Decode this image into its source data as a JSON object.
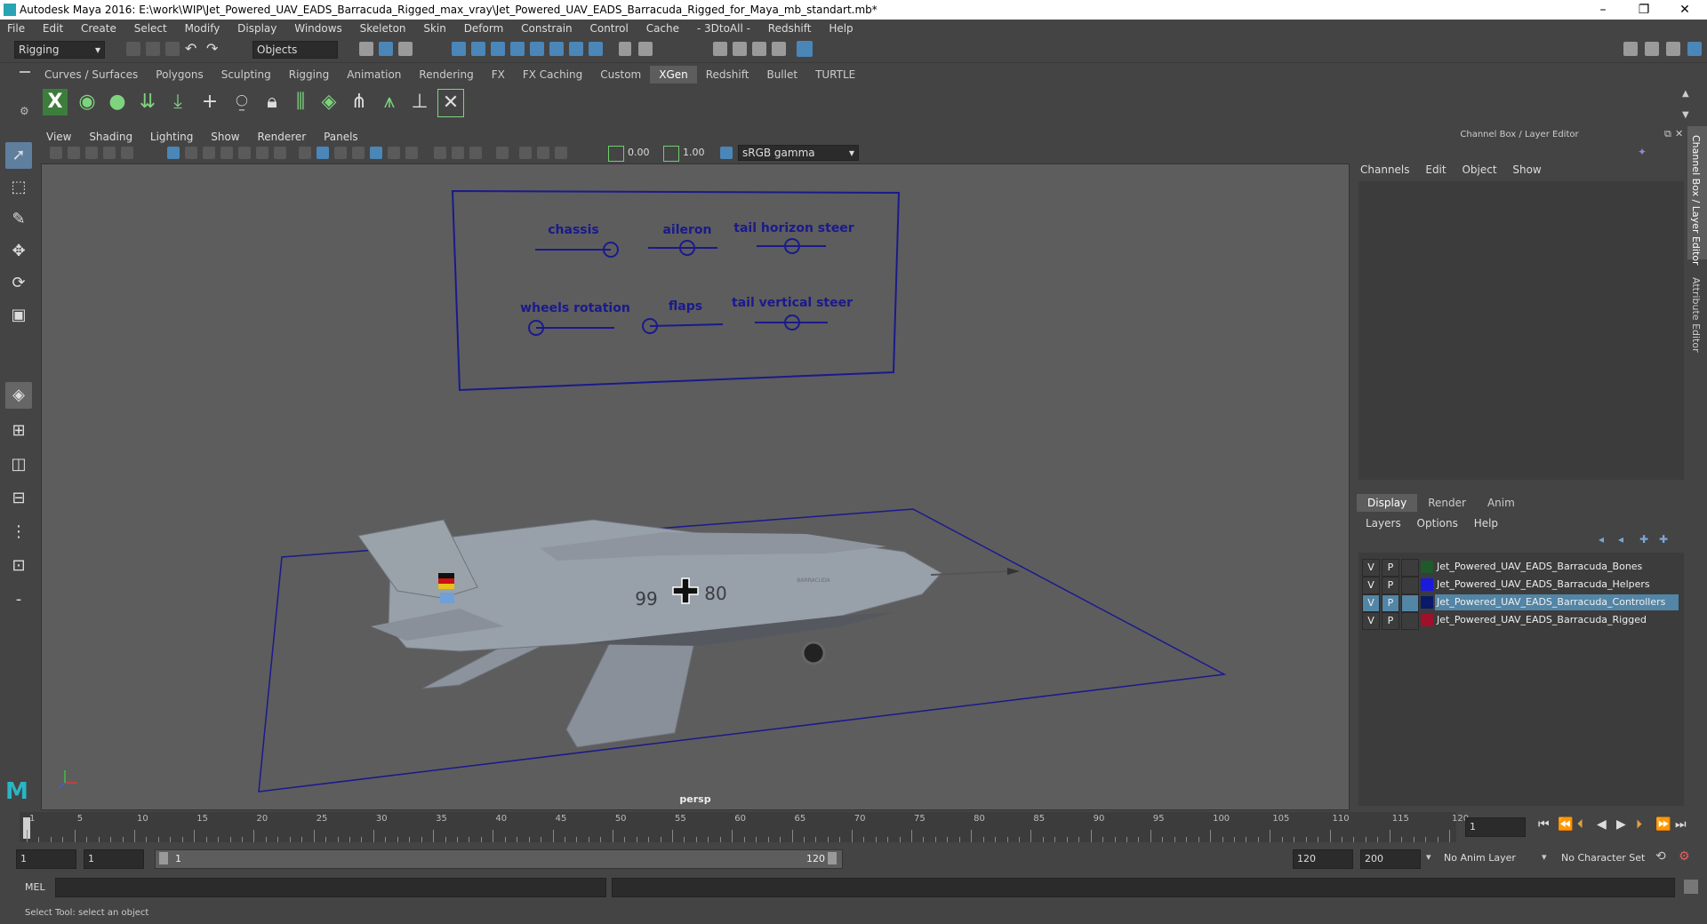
{
  "window": {
    "title": "Autodesk Maya 2016: E:\\work\\WIP\\Jet_Powered_UAV_EADS_Barracuda_Rigged_max_vray\\Jet_Powered_UAV_EADS_Barracuda_Rigged_for_Maya_mb_standart.mb*",
    "minimize": "–",
    "restore": "❐",
    "close": "✕"
  },
  "menubar": [
    "File",
    "Edit",
    "Create",
    "Select",
    "Modify",
    "Display",
    "Windows",
    "Skeleton",
    "Skin",
    "Deform",
    "Constrain",
    "Control",
    "Cache",
    "- 3DtoAll -",
    "Redshift",
    "Help"
  ],
  "statusline": {
    "menuset": "Rigging",
    "selection_mode": "Objects"
  },
  "shelf": {
    "tabs": [
      "Curves / Surfaces",
      "Polygons",
      "Sculpting",
      "Rigging",
      "Animation",
      "Rendering",
      "FX",
      "FX Caching",
      "Custom",
      "XGen",
      "Redshift",
      "Bullet",
      "TURTLE"
    ],
    "active_tab": "XGen"
  },
  "viewport": {
    "menu": [
      "View",
      "Shading",
      "Lighting",
      "Show",
      "Renderer",
      "Panels"
    ],
    "exposure": "0.00",
    "gamma": "1.00",
    "color_space": "sRGB gamma",
    "camera_label": "persp",
    "controls_board": {
      "labels": [
        "chassis",
        "aileron",
        "tail horizon steer",
        "wheels rotation",
        "flaps",
        "tail vertical steer"
      ]
    },
    "model_markings": {
      "number_left": "99",
      "number_right": "80",
      "nose_text": "BARRACUDA"
    }
  },
  "channel_box": {
    "title": "Channel Box / Layer Editor",
    "menu": [
      "Channels",
      "Edit",
      "Object",
      "Show"
    ]
  },
  "layer_editor": {
    "tabs": [
      "Display",
      "Render",
      "Anim"
    ],
    "active_tab": "Display",
    "menu": [
      "Layers",
      "Options",
      "Help"
    ],
    "layers": [
      {
        "v": "V",
        "p": "P",
        "name": "Jet_Powered_UAV_EADS_Barracuda_Bones",
        "color": "#1e5a2a",
        "selected": false
      },
      {
        "v": "V",
        "p": "P",
        "name": "Jet_Powered_UAV_EADS_Barracuda_Helpers",
        "color": "#1a1adc",
        "selected": false
      },
      {
        "v": "V",
        "p": "P",
        "name": "Jet_Powered_UAV_EADS_Barracuda_Controllers",
        "color": "#0a1a6a",
        "selected": true
      },
      {
        "v": "V",
        "p": "P",
        "name": "Jet_Powered_UAV_EADS_Barracuda_Rigged",
        "color": "#a0102a",
        "selected": false
      }
    ]
  },
  "side_tabs": [
    "Channel Box / Layer Editor",
    "Attribute Editor"
  ],
  "timeline": {
    "ticks": [
      "1",
      "5",
      "10",
      "15",
      "20",
      "25",
      "30",
      "35",
      "40",
      "45",
      "50",
      "55",
      "60",
      "65",
      "70",
      "75",
      "80",
      "85",
      "90",
      "95",
      "100",
      "105",
      "110",
      "115",
      "120"
    ],
    "current_frame": "1"
  },
  "range": {
    "start": "1",
    "playback_start": "1",
    "range_start_label": "1",
    "range_end_label": "120",
    "playback_end": "120",
    "end": "200",
    "anim_layer": "No Anim Layer",
    "character_set": "No Character Set"
  },
  "command_line": {
    "label": "MEL"
  },
  "help_line": {
    "text": "Select Tool: select an object"
  }
}
